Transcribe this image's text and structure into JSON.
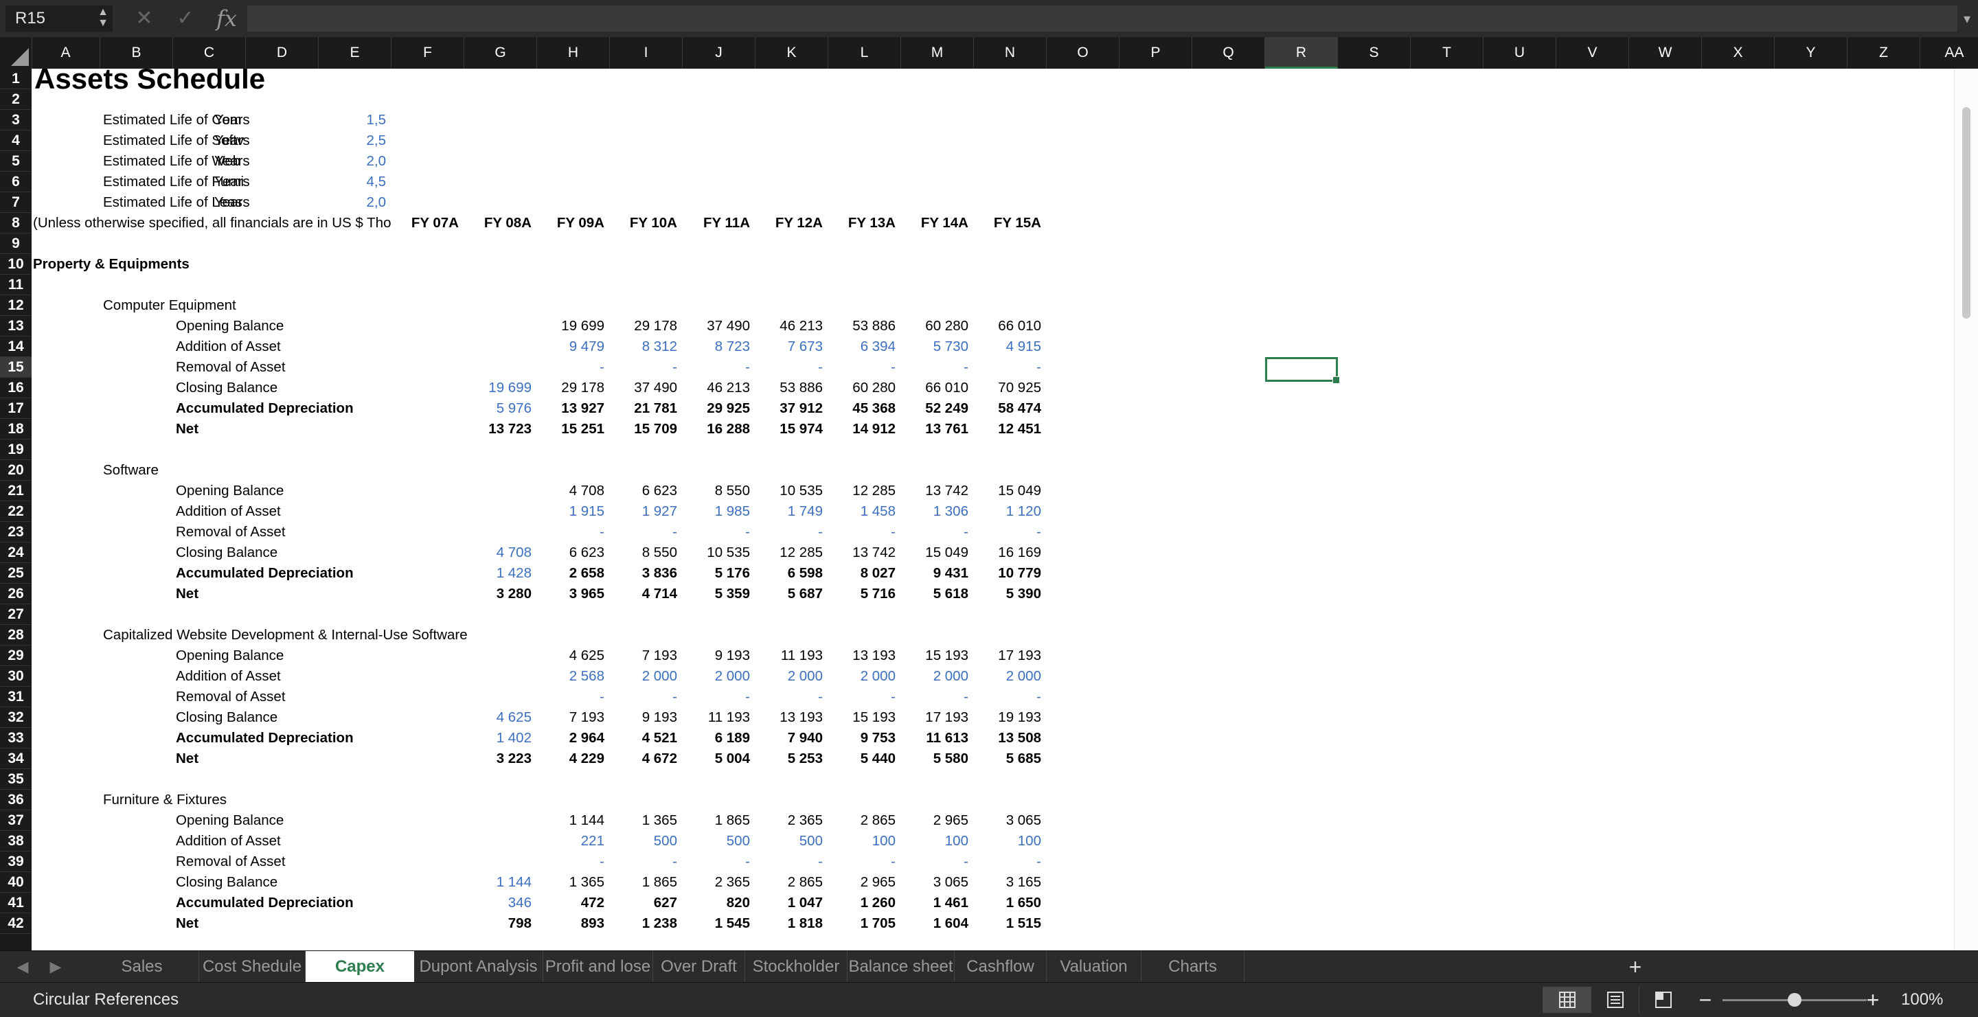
{
  "formula_bar": {
    "name_box": "R15",
    "cancel_icon": "close-icon",
    "enter_icon": "check-icon",
    "fx_label": "fx",
    "formula": ""
  },
  "columns": [
    "A",
    "B",
    "C",
    "D",
    "E",
    "F",
    "G",
    "H",
    "I",
    "J",
    "K",
    "L",
    "M",
    "N",
    "O",
    "P",
    "Q",
    "R",
    "S",
    "T",
    "U",
    "V",
    "W",
    "X",
    "Y",
    "Z",
    "AA"
  ],
  "selected_column": "R",
  "rows": [
    "1",
    "2",
    "3",
    "4",
    "5",
    "6",
    "7",
    "8",
    "9",
    "10",
    "11",
    "12",
    "13",
    "14",
    "15",
    "16",
    "17",
    "18",
    "19",
    "20",
    "21",
    "22",
    "23",
    "24",
    "25",
    "26",
    "27",
    "28",
    "29",
    "30",
    "31",
    "32",
    "33",
    "34",
    "35",
    "36",
    "37",
    "38",
    "39",
    "40",
    "41",
    "42"
  ],
  "selected_row": "15",
  "sheet": {
    "title": "Assets Schedule",
    "assumptions": [
      {
        "label": "Estimated Life of Com",
        "unit": "Years",
        "value": "1,5"
      },
      {
        "label": "Estimated Life of Softv",
        "unit": "Years",
        "value": "2,5"
      },
      {
        "label": "Estimated Life of Web",
        "unit": "Years",
        "value": "2,0"
      },
      {
        "label": "Estimated Life of Furni",
        "unit": "Years",
        "value": "4,5"
      },
      {
        "label": "Estimated Life of Leas",
        "unit": "Years",
        "value": "2,0"
      }
    ],
    "units_note": "(Unless otherwise specified, all financials are in US $ Tho",
    "years": [
      "FY 07A",
      "FY 08A",
      "FY 09A",
      "FY 10A",
      "FY 11A",
      "FY 12A",
      "FY 13A",
      "FY 14A",
      "FY 15A"
    ],
    "section_title": "Property & Equipments",
    "groups": [
      {
        "name": "Computer Equipment",
        "lines": [
          {
            "label": "Opening Balance",
            "bold": false,
            "blue": false,
            "values": [
              "",
              "",
              "19 699",
              "29 178",
              "37 490",
              "46 213",
              "53 886",
              "60 280",
              "66 010"
            ]
          },
          {
            "label": "Addition of Asset",
            "bold": false,
            "blue": true,
            "values": [
              "",
              "",
              "9 479",
              "8 312",
              "8 723",
              "7 673",
              "6 394",
              "5 730",
              "4 915"
            ]
          },
          {
            "label": "Removal of Asset",
            "bold": false,
            "blue": true,
            "values": [
              "",
              "",
              "-",
              "-",
              "-",
              "-",
              "-",
              "-",
              "-"
            ]
          },
          {
            "label": "Closing Balance",
            "bold": false,
            "blue": false,
            "first_blue": true,
            "values": [
              "",
              "19 699",
              "29 178",
              "37 490",
              "46 213",
              "53 886",
              "60 280",
              "66 010",
              "70 925"
            ]
          },
          {
            "label": "Accumulated Depreciation",
            "bold": true,
            "blue": false,
            "first_blue": true,
            "values": [
              "",
              "5 976",
              "13 927",
              "21 781",
              "29 925",
              "37 912",
              "45 368",
              "52 249",
              "58 474"
            ]
          },
          {
            "label": "Net",
            "bold": true,
            "blue": false,
            "values": [
              "",
              "13 723",
              "15 251",
              "15 709",
              "16 288",
              "15 974",
              "14 912",
              "13 761",
              "12 451"
            ]
          }
        ]
      },
      {
        "name": "Software",
        "lines": [
          {
            "label": "Opening Balance",
            "bold": false,
            "blue": false,
            "values": [
              "",
              "",
              "4 708",
              "6 623",
              "8 550",
              "10 535",
              "12 285",
              "13 742",
              "15 049"
            ]
          },
          {
            "label": "Addition of Asset",
            "bold": false,
            "blue": true,
            "values": [
              "",
              "",
              "1 915",
              "1 927",
              "1 985",
              "1 749",
              "1 458",
              "1 306",
              "1 120"
            ]
          },
          {
            "label": "Removal of Asset",
            "bold": false,
            "blue": true,
            "values": [
              "",
              "",
              "-",
              "-",
              "-",
              "-",
              "-",
              "-",
              "-"
            ]
          },
          {
            "label": "Closing Balance",
            "bold": false,
            "blue": false,
            "first_blue": true,
            "values": [
              "",
              "4 708",
              "6 623",
              "8 550",
              "10 535",
              "12 285",
              "13 742",
              "15 049",
              "16 169"
            ]
          },
          {
            "label": "Accumulated Depreciation",
            "bold": true,
            "blue": false,
            "first_blue": true,
            "values": [
              "",
              "1 428",
              "2 658",
              "3 836",
              "5 176",
              "6 598",
              "8 027",
              "9 431",
              "10 779"
            ]
          },
          {
            "label": "Net",
            "bold": true,
            "blue": false,
            "values": [
              "",
              "3 280",
              "3 965",
              "4 714",
              "5 359",
              "5 687",
              "5 716",
              "5 618",
              "5 390"
            ]
          }
        ]
      },
      {
        "name": "Capitalized Website Development & Internal-Use Software",
        "lines": [
          {
            "label": "Opening Balance",
            "bold": false,
            "blue": false,
            "values": [
              "",
              "",
              "4 625",
              "7 193",
              "9 193",
              "11 193",
              "13 193",
              "15 193",
              "17 193"
            ]
          },
          {
            "label": "Addition of Asset",
            "bold": false,
            "blue": true,
            "values": [
              "",
              "",
              "2 568",
              "2 000",
              "2 000",
              "2 000",
              "2 000",
              "2 000",
              "2 000"
            ]
          },
          {
            "label": "Removal of Asset",
            "bold": false,
            "blue": true,
            "values": [
              "",
              "",
              "-",
              "-",
              "-",
              "-",
              "-",
              "-",
              "-"
            ]
          },
          {
            "label": "Closing Balance",
            "bold": false,
            "blue": false,
            "first_blue": true,
            "values": [
              "",
              "4 625",
              "7 193",
              "9 193",
              "11 193",
              "13 193",
              "15 193",
              "17 193",
              "19 193"
            ]
          },
          {
            "label": "Accumulated Depreciation",
            "bold": true,
            "blue": false,
            "first_blue": true,
            "values": [
              "",
              "1 402",
              "2 964",
              "4 521",
              "6 189",
              "7 940",
              "9 753",
              "11 613",
              "13 508"
            ]
          },
          {
            "label": "Net",
            "bold": true,
            "blue": false,
            "values": [
              "",
              "3 223",
              "4 229",
              "4 672",
              "5 004",
              "5 253",
              "5 440",
              "5 580",
              "5 685"
            ]
          }
        ]
      },
      {
        "name": "Furniture & Fixtures",
        "lines": [
          {
            "label": "Opening Balance",
            "bold": false,
            "blue": false,
            "values": [
              "",
              "",
              "1 144",
              "1 365",
              "1 865",
              "2 365",
              "2 865",
              "2 965",
              "3 065"
            ]
          },
          {
            "label": "Addition of Asset",
            "bold": false,
            "blue": true,
            "values": [
              "",
              "",
              "221",
              "500",
              "500",
              "500",
              "100",
              "100",
              "100"
            ]
          },
          {
            "label": "Removal of Asset",
            "bold": false,
            "blue": true,
            "values": [
              "",
              "",
              "-",
              "-",
              "-",
              "-",
              "-",
              "-",
              "-"
            ]
          },
          {
            "label": "Closing Balance",
            "bold": false,
            "blue": false,
            "first_blue": true,
            "values": [
              "",
              "1 144",
              "1 365",
              "1 865",
              "2 365",
              "2 865",
              "2 965",
              "3 065",
              "3 165"
            ]
          },
          {
            "label": "Accumulated Depreciation",
            "bold": true,
            "blue": false,
            "first_blue": true,
            "values": [
              "",
              "346",
              "472",
              "627",
              "820",
              "1 047",
              "1 260",
              "1 461",
              "1 650"
            ]
          },
          {
            "label": "Net",
            "bold": true,
            "blue": false,
            "values": [
              "",
              "798",
              "893",
              "1 238",
              "1 545",
              "1 818",
              "1 705",
              "1 604",
              "1 515"
            ]
          }
        ]
      }
    ]
  },
  "tabs": [
    {
      "label": "Sales Schedule",
      "active": false
    },
    {
      "label": "Cost Shedule",
      "active": false
    },
    {
      "label": "Capex",
      "active": true
    },
    {
      "label": "Dupont Analysis",
      "active": false
    },
    {
      "label": "Profit and lose",
      "active": false
    },
    {
      "label": "Over Draft",
      "active": false
    },
    {
      "label": "Stockholder",
      "active": false
    },
    {
      "label": "Balance sheet",
      "active": false
    },
    {
      "label": "Cashflow",
      "active": false
    },
    {
      "label": "Valuation",
      "active": false
    },
    {
      "label": "Charts",
      "active": false
    }
  ],
  "status": {
    "text": "Circular References",
    "zoom_level": "100%",
    "zoom_fraction": 0.5,
    "view_icons": [
      "normal-view-icon",
      "page-layout-icon",
      "page-break-icon"
    ]
  },
  "colors": {
    "accent": "#2e7d4f",
    "input_blue": "#3b6fbf"
  }
}
